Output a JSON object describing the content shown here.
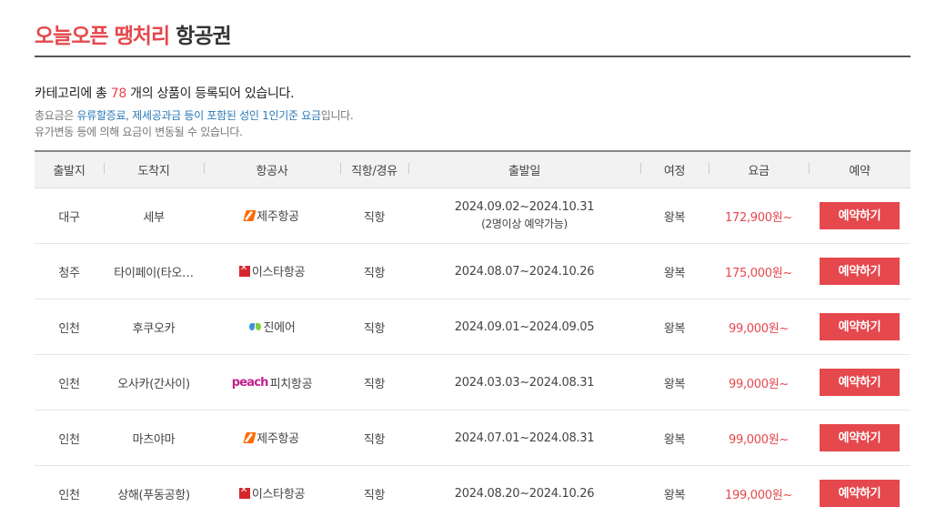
{
  "header": {
    "title_accent": "오늘오픈 땡처리",
    "title_rest": "항공권"
  },
  "summary": {
    "prefix": "카테고리에 총 ",
    "count": "78",
    "suffix": " 개의 상품이 등록되어 있습니다."
  },
  "notes": {
    "line1_a": "총요금은 ",
    "line1_link": "유류할증료, 제세공과금 등이 포함된 성인 1인기준 요금",
    "line1_b": "입니다.",
    "line2": "유가변동 등에 의해 요금이 변동될 수 있습니다."
  },
  "table": {
    "headers": [
      "출발지",
      "도착지",
      "항공사",
      "직항/경유",
      "출발일",
      "여정",
      "요금",
      "예약"
    ],
    "rows": [
      {
        "departure": "대구",
        "arrival": "세부",
        "airline": "제주항공",
        "airline_logo": "jeju",
        "route": "직항",
        "date": "2024.09.02~2024.10.31",
        "date_note": "(2명이상 예약가능)",
        "trip": "왕복",
        "price": "172,900원~",
        "button": "예약하기"
      },
      {
        "departure": "청주",
        "arrival": "타이페이(타오…",
        "airline": "이스타항공",
        "airline_logo": "eastar",
        "route": "직항",
        "date": "2024.08.07~2024.10.26",
        "date_note": "",
        "trip": "왕복",
        "price": "175,000원~",
        "button": "예약하기"
      },
      {
        "departure": "인천",
        "arrival": "후쿠오카",
        "airline": "진에어",
        "airline_logo": "jinair",
        "route": "직항",
        "date": "2024.09.01~2024.09.05",
        "date_note": "",
        "trip": "왕복",
        "price": "99,000원~",
        "button": "예약하기"
      },
      {
        "departure": "인천",
        "arrival": "오사카(간사이)",
        "airline": "피치항공",
        "airline_logo": "peach",
        "logo_text": "peach",
        "route": "직항",
        "date": "2024.03.03~2024.08.31",
        "date_note": "",
        "trip": "왕복",
        "price": "99,000원~",
        "button": "예약하기"
      },
      {
        "departure": "인천",
        "arrival": "마츠야마",
        "airline": "제주항공",
        "airline_logo": "jeju",
        "route": "직항",
        "date": "2024.07.01~2024.08.31",
        "date_note": "",
        "trip": "왕복",
        "price": "99,000원~",
        "button": "예약하기"
      },
      {
        "departure": "인천",
        "arrival": "상해(푸동공항)",
        "airline": "이스타항공",
        "airline_logo": "eastar",
        "route": "직항",
        "date": "2024.08.20~2024.10.26",
        "date_note": "",
        "trip": "왕복",
        "price": "199,000원~",
        "button": "예약하기"
      }
    ]
  },
  "colors": {
    "accent": "#e5484d",
    "link": "#2a7ab8"
  }
}
